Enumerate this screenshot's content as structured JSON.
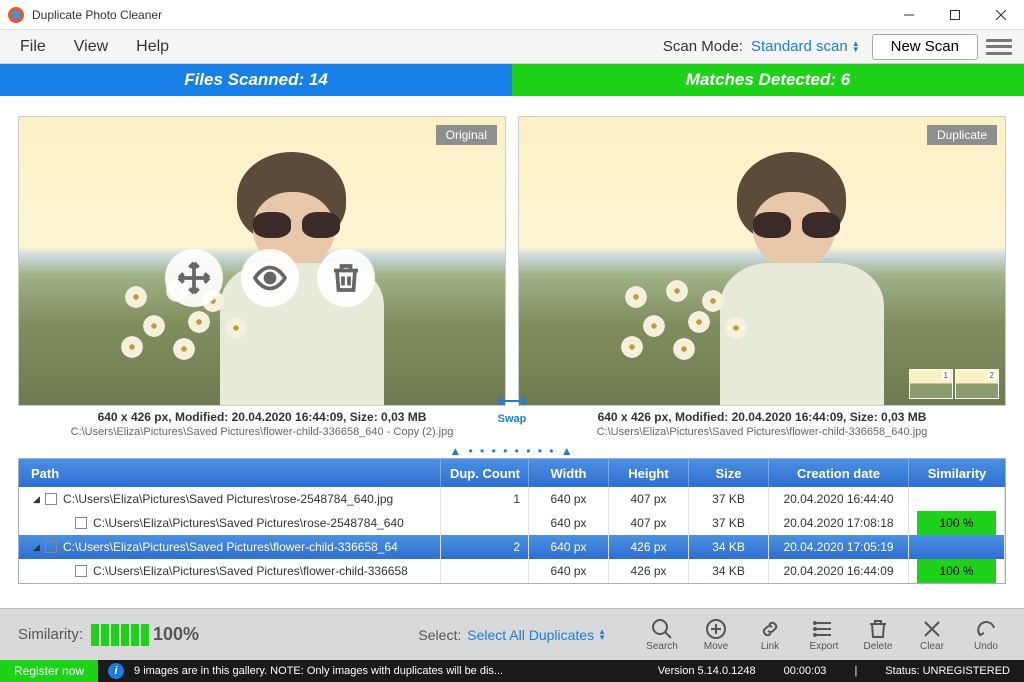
{
  "titlebar": {
    "title": "Duplicate Photo Cleaner"
  },
  "menu": {
    "file": "File",
    "view": "View",
    "help": "Help",
    "scanmode_label": "Scan Mode:",
    "scanmode_value": "Standard scan",
    "newscan": "New Scan"
  },
  "stats": {
    "scanned": "Files Scanned: 14",
    "matches": "Matches Detected: 6"
  },
  "preview": {
    "left": {
      "badge": "Original",
      "meta": "640 x 426 px, Modified: 20.04.2020 16:44:09, Size: 0,03 MB",
      "path": "C:\\Users\\Eliza\\Pictures\\Saved Pictures\\flower-child-336658_640 - Copy (2).jpg"
    },
    "right": {
      "badge": "Duplicate",
      "meta": "640 x 426 px, Modified: 20.04.2020 16:44:09, Size: 0,03 MB",
      "path": "C:\\Users\\Eliza\\Pictures\\Saved Pictures\\flower-child-336658_640.jpg",
      "thumb1": "1",
      "thumb2": "2"
    },
    "swap": "Swap"
  },
  "table": {
    "headers": {
      "path": "Path",
      "dup": "Dup. Count",
      "w": "Width",
      "h": "Height",
      "sz": "Size",
      "cd": "Creation date",
      "sim": "Similarity"
    },
    "rows": [
      {
        "tri": "◢",
        "indent": 0,
        "path": "C:\\Users\\Eliza\\Pictures\\Saved Pictures\\rose-2548784_640.jpg",
        "dup": "1",
        "w": "640 px",
        "h": "407 px",
        "sz": "37 KB",
        "cd": "20.04.2020 16:44:40",
        "sim": ""
      },
      {
        "tri": "",
        "indent": 1,
        "path": "C:\\Users\\Eliza\\Pictures\\Saved Pictures\\rose-2548784_640",
        "dup": "",
        "w": "640 px",
        "h": "407 px",
        "sz": "37 KB",
        "cd": "20.04.2020 17:08:18",
        "sim": "100 %"
      },
      {
        "tri": "◢",
        "indent": 0,
        "sel": true,
        "path": "C:\\Users\\Eliza\\Pictures\\Saved Pictures\\flower-child-336658_64",
        "dup": "2",
        "w": "640 px",
        "h": "426 px",
        "sz": "34 KB",
        "cd": "20.04.2020 17:05:19",
        "sim": ""
      },
      {
        "tri": "",
        "indent": 1,
        "path": "C:\\Users\\Eliza\\Pictures\\Saved Pictures\\flower-child-336658",
        "dup": "",
        "w": "640 px",
        "h": "426 px",
        "sz": "34 KB",
        "cd": "20.04.2020 16:44:09",
        "sim": "100 %"
      }
    ]
  },
  "bottombar": {
    "similarity_label": "Similarity:",
    "similarity_pct": "100%",
    "select_label": "Select:",
    "select_value": "Select All Duplicates",
    "tools": {
      "search": "Search",
      "move": "Move",
      "link": "Link",
      "export": "Export",
      "delete": "Delete",
      "clear": "Clear",
      "undo": "Undo"
    }
  },
  "statusbar": {
    "register": "Register now",
    "msg": "9 images are in this gallery. NOTE: Only images with duplicates will be dis...",
    "version": "Version 5.14.0.1248",
    "time": "00:00:03",
    "status": "Status: UNREGISTERED"
  }
}
